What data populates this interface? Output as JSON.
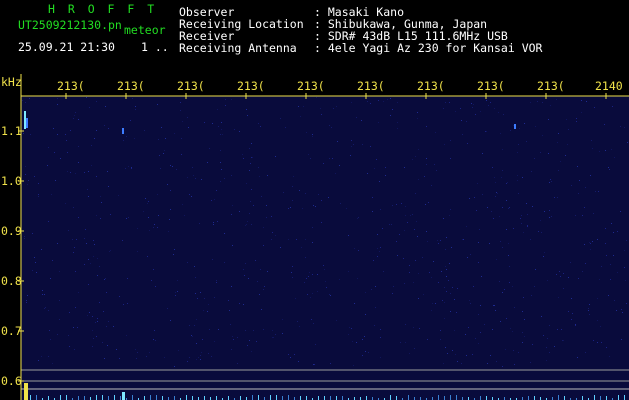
{
  "header": {
    "app_title": "H R O F F T",
    "file_name": "UT2509212130.pn",
    "mode_label": "meteor",
    "date_time": "25.09.21 21:30",
    "page_indicator": "1 .."
  },
  "station_info": [
    {
      "label": "Observer",
      "value": ": Masaki Kano"
    },
    {
      "label": "Receiving Location",
      "value": ": Shibukawa, Gunma, Japan"
    },
    {
      "label": "Receiver",
      "value": ": SDR# 43dB L15 111.6MHz USB"
    },
    {
      "label": "Receiving Antenna",
      "value": ": 4ele Yagi Az 230 for Kansai VOR"
    }
  ],
  "time_axis": {
    "labels": [
      "213(",
      "213(",
      "213(",
      "213(",
      "213(",
      "213(",
      "213(",
      "213(",
      "213(",
      "2140"
    ]
  },
  "freq_axis": {
    "unit": "kHz",
    "labels": [
      "1.1",
      "1.0",
      "0.9",
      "0.8",
      "0.7",
      "0.6"
    ]
  },
  "colors": {
    "background": "#000000",
    "plot_background": "#090b3c",
    "title_green": "#22dd22",
    "axis_yellow": "#f0e24a",
    "text_white": "#ffffff",
    "signal_cyan": "#7fe8ff"
  }
}
